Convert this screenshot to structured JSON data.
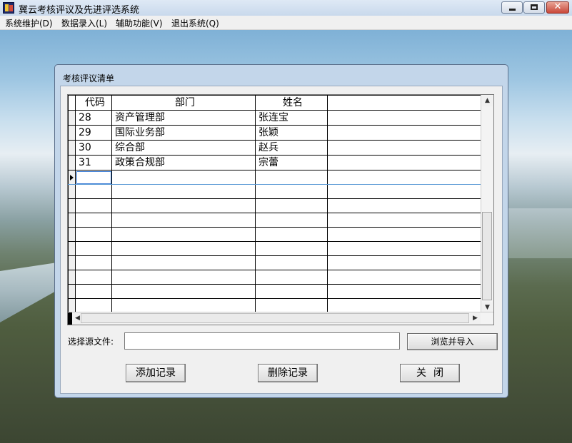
{
  "window": {
    "title": "冀云考核评议及先进评选系统"
  },
  "menu": [
    "系统维护(D)",
    "数据录入(L)",
    "辅助功能(V)",
    "退出系统(Q)"
  ],
  "dialog": {
    "title": "考核评议清单",
    "columns": [
      "代码",
      "部门",
      "姓名",
      ""
    ],
    "rows": [
      [
        "28",
        "资产管理部",
        "张连宝",
        ""
      ],
      [
        "29",
        "国际业务部",
        "张颖",
        ""
      ],
      [
        "30",
        "综合部",
        "赵兵",
        ""
      ],
      [
        "31",
        "政策合规部",
        "宗蕾",
        ""
      ]
    ],
    "file_label": "选择源文件:",
    "file_value": "",
    "browse_button": "浏览并导入",
    "add_button": "添加记录",
    "delete_button": "删除记录",
    "close_button": "关闭"
  }
}
